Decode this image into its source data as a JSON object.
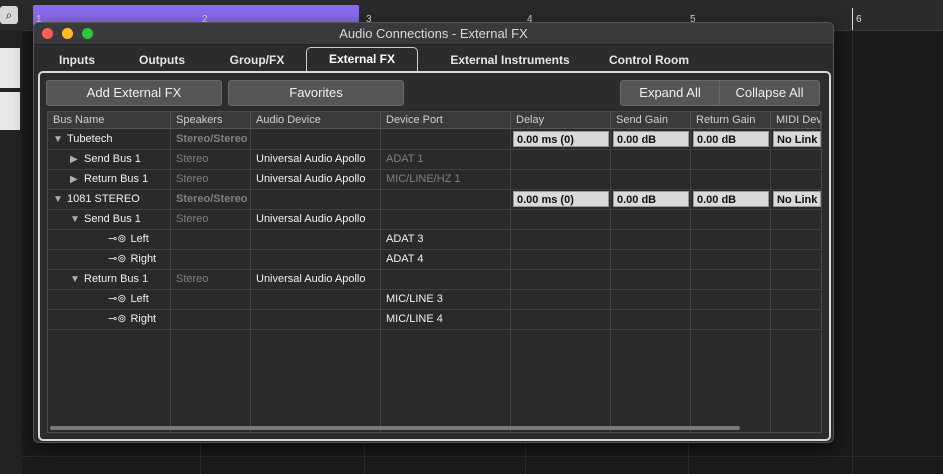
{
  "background": {
    "search_icon": "⌕",
    "ruler_numbers": [
      "1",
      "2",
      "3",
      "4",
      "5",
      "6"
    ]
  },
  "window": {
    "title": "Audio Connections - External FX"
  },
  "tabs": [
    {
      "label": "Inputs"
    },
    {
      "label": "Outputs"
    },
    {
      "label": "Group/FX"
    },
    {
      "label": "External FX"
    },
    {
      "label": "External Instruments"
    },
    {
      "label": "Control Room"
    }
  ],
  "toolbar": {
    "add_label": "Add External FX",
    "favorites_label": "Favorites",
    "expand_label": "Expand All",
    "collapse_label": "Collapse All"
  },
  "columns": [
    "Bus Name",
    "Speakers",
    "Audio Device",
    "Device Port",
    "Delay",
    "Send Gain",
    "Return Gain",
    "MIDI Dev"
  ],
  "rows": [
    {
      "bus": "Tubetech",
      "speakers": "Stereo/Stereo",
      "device": "",
      "port": "",
      "delay": "0.00 ms (0)",
      "send_gain": "0.00 dB",
      "return_gain": "0.00 dB",
      "midi": "No Link"
    },
    {
      "bus": "Send Bus 1",
      "speakers": "Stereo",
      "device": "Universal Audio Apollo",
      "port": "ADAT 1",
      "delay": "",
      "send_gain": "",
      "return_gain": "",
      "midi": ""
    },
    {
      "bus": "Return Bus 1",
      "speakers": "Stereo",
      "device": "Universal Audio Apollo",
      "port": "MIC/LINE/HZ 1",
      "delay": "",
      "send_gain": "",
      "return_gain": "",
      "midi": ""
    },
    {
      "bus": "1081 STEREO",
      "speakers": "Stereo/Stereo",
      "device": "",
      "port": "",
      "delay": "0.00 ms (0)",
      "send_gain": "0.00 dB",
      "return_gain": "0.00 dB",
      "midi": "No Link"
    },
    {
      "bus": "Send Bus 1",
      "speakers": "Stereo",
      "device": "Universal Audio Apollo",
      "port": "",
      "delay": "",
      "send_gain": "",
      "return_gain": "",
      "midi": ""
    },
    {
      "bus": "Left",
      "speakers": "",
      "device": "",
      "port": "ADAT 3",
      "delay": "",
      "send_gain": "",
      "return_gain": "",
      "midi": ""
    },
    {
      "bus": "Right",
      "speakers": "",
      "device": "",
      "port": "ADAT 4",
      "delay": "",
      "send_gain": "",
      "return_gain": "",
      "midi": ""
    },
    {
      "bus": "Return Bus 1",
      "speakers": "Stereo",
      "device": "Universal Audio Apollo",
      "port": "",
      "delay": "",
      "send_gain": "",
      "return_gain": "",
      "midi": ""
    },
    {
      "bus": "Left",
      "speakers": "",
      "device": "",
      "port": "MIC/LINE 3",
      "delay": "",
      "send_gain": "",
      "return_gain": "",
      "midi": ""
    },
    {
      "bus": "Right",
      "speakers": "",
      "device": "",
      "port": "MIC/LINE 4",
      "delay": "",
      "send_gain": "",
      "return_gain": "",
      "midi": ""
    }
  ],
  "icons": {
    "expanded": "▼",
    "collapsed": "▶",
    "plug": "⊸⊚"
  },
  "colors": {
    "close": "#fe5f57",
    "minimize": "#febc2e",
    "zoom": "#28c840",
    "timeline_region": "#8b6cf0"
  }
}
